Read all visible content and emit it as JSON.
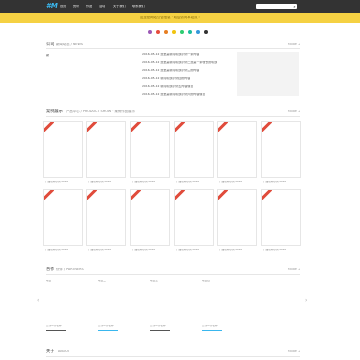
{
  "header": {
    "logo": "#M",
    "nav": [
      "首页",
      "资讯",
      "作品",
      "活动",
      "关于我们",
      "联系我们"
    ],
    "search_placeholder": "",
    "search_icon": "search-icon"
  },
  "banner": {
    "text": "这里是网站公告信息 · 欢迎访问本站点 ›"
  },
  "dots": [
    "#9b59b6",
    "#e74c3c",
    "#e67e22",
    "#f1c40f",
    "#2ecc71",
    "#1abc9c",
    "#3498db",
    "#333333"
  ],
  "news": {
    "title": "公司",
    "subtitle": "新闻动态 / NEWS",
    "more": "MORE +",
    "label": "新",
    "items": [
      "2016-05-12 这里是新闻标题示例一条内容",
      "2016-05-12 这里是新闻标题示例二这是一条较长的标题",
      "2016-05-12 这里是新闻标题示例三的内容",
      "2016-05-12 新闻标题示例四的内容",
      "2016-05-12 新闻标题示例五内容信息",
      "2016-05-12 这里是新闻标题示例六的内容信息"
    ]
  },
  "products": {
    "title": "案例展示",
    "subtitle": "产品中心 / PRODUCT SHOW · 案例作品展示",
    "more": "MORE +",
    "tag": "HOT",
    "captions": [
      "产品名称示例 2016",
      "产品名称示例 2016",
      "产品名称示例 2016",
      "产品名称示例 2016",
      "产品名称示例 2016",
      "产品名称示例 2016",
      "产品名称示例 2016",
      "产品名称示例 2016",
      "产品名称示例 2016",
      "产品名称示例 2016",
      "产品名称示例 2016",
      "产品名称示例 2016"
    ]
  },
  "partners": {
    "title": "合作",
    "subtitle": "伙伴 / PARTNERS",
    "more": "MORE +",
    "prev": "‹",
    "next": "›",
    "items": [
      "项目一",
      "项目二",
      "项目三",
      "项目四"
    ],
    "links": [
      "合作伙伴名称",
      "合作伙伴名称",
      "合作伙伴名称",
      "合作伙伴名称"
    ]
  },
  "footer_section": {
    "title": "关于",
    "subtitle": "ABOUT",
    "more": "MORE +"
  }
}
